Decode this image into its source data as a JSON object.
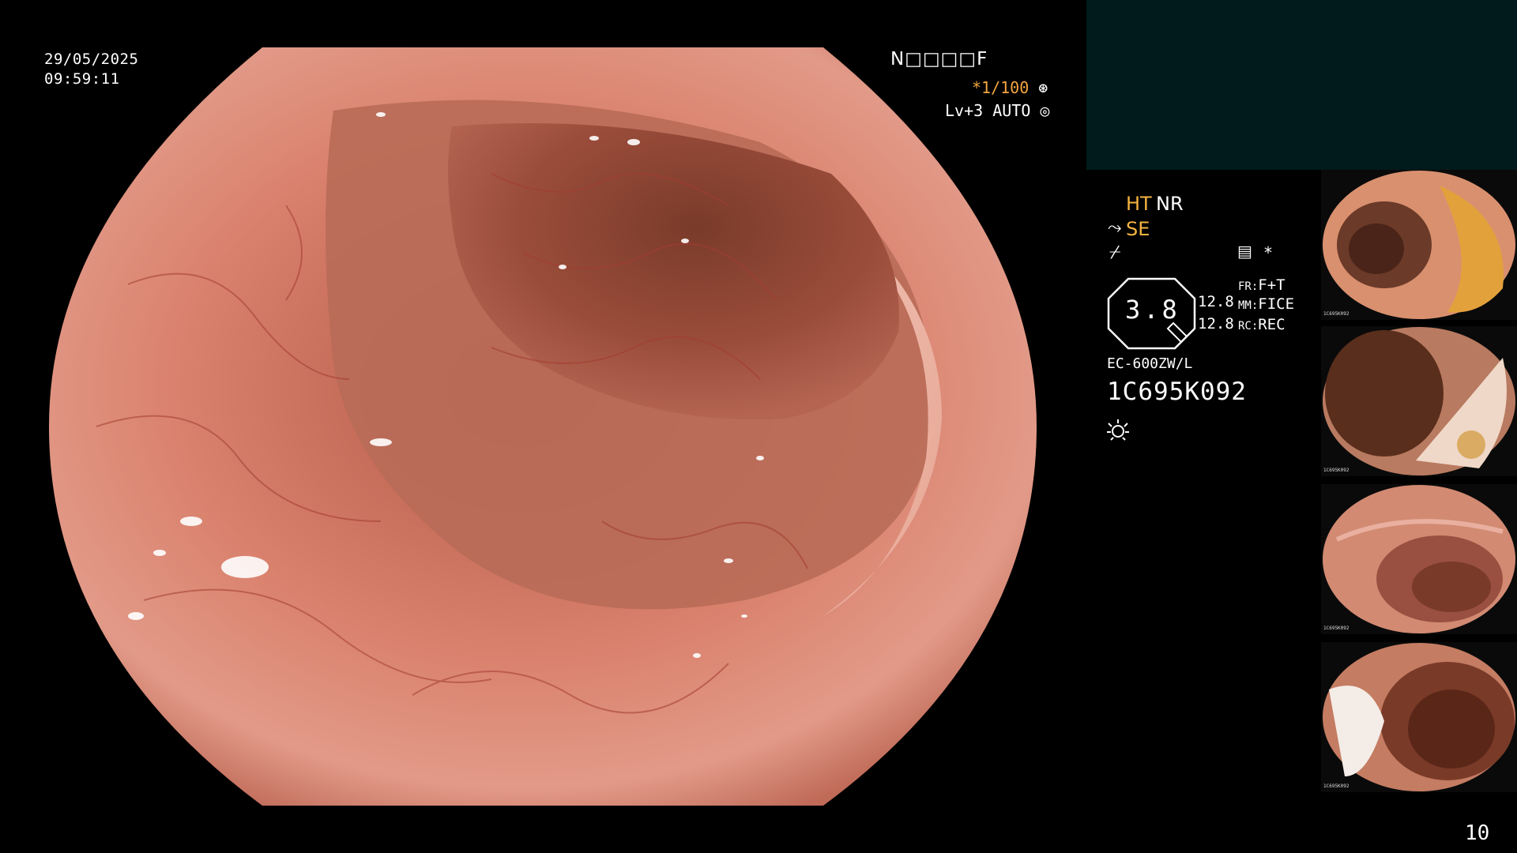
{
  "osd": {
    "date": "29/05/2025",
    "time": "09:59:11",
    "patient_code_prefix": "N",
    "patient_code_boxes": "□□□□",
    "patient_code_suffix": "F",
    "shutter": "*1/100",
    "shutter_icon": "aperture-icon",
    "iris": "Lv+3 AUTO",
    "iris_icon": "auto-iris-icon"
  },
  "panel": {
    "ht": "HT",
    "nr": "NR",
    "se": "SE",
    "filter_icon": "filter-icon",
    "star": "*",
    "zoom": "3.8",
    "mm_top": "12.8",
    "mm_bottom": "12.8",
    "fr_label": "FR:",
    "fr_value": "F+T",
    "mm_label": "MM:",
    "mm_value": "FICE",
    "rc_label": "RC:",
    "rc_value": "REC",
    "scope_model": "EC-600ZW/L",
    "scope_serial": "1C695K092",
    "light_icon": "light-source-icon"
  },
  "thumbnails": [
    {
      "caption": "1C695K092",
      "tone": "amber"
    },
    {
      "caption": "1C695K092",
      "tone": "dark"
    },
    {
      "caption": "1C695K092",
      "tone": "pink"
    },
    {
      "caption": "1C695K092",
      "tone": "pink"
    }
  ],
  "page_number": "10",
  "colors": {
    "accent_orange": "#f4a640",
    "panel_teal": "#011b1c",
    "mucosa": "#d9806c"
  }
}
